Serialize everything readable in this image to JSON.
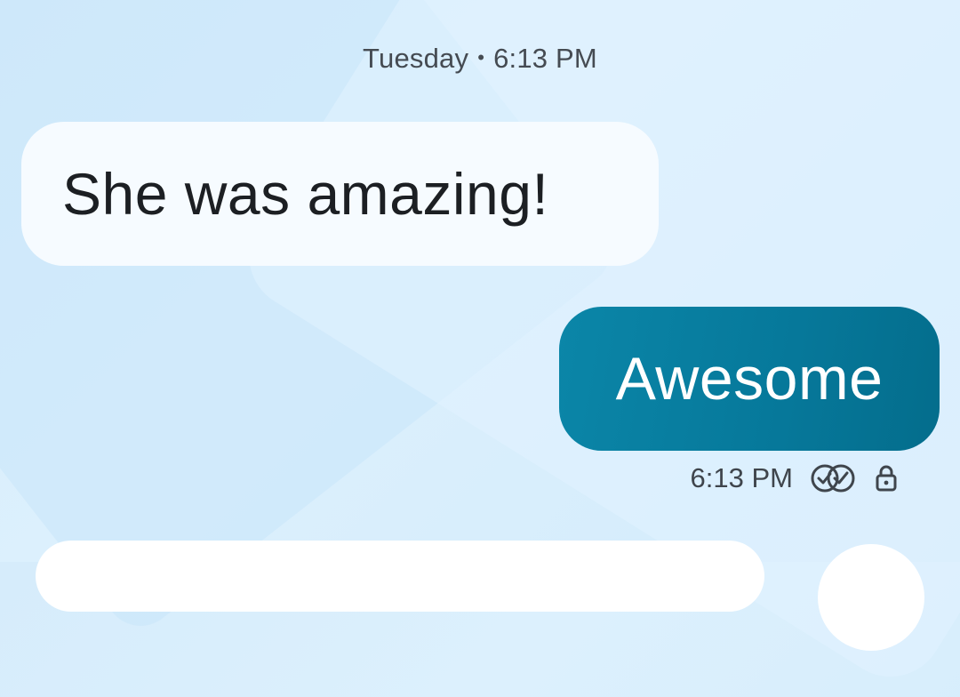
{
  "header": {
    "day": "Tuesday",
    "separator": "•",
    "time": "6:13 PM"
  },
  "messages": [
    {
      "direction": "incoming",
      "text": "She was amazing!"
    },
    {
      "direction": "outgoing",
      "text": "Awesome",
      "time": "6:13 PM",
      "status_icon": "double-check-icon",
      "lock_icon": "lock-icon"
    }
  ],
  "colors": {
    "incoming_bubble": "#f6fbff",
    "outgoing_bubble": "#0a82a4",
    "background": "#d6ecfb"
  }
}
